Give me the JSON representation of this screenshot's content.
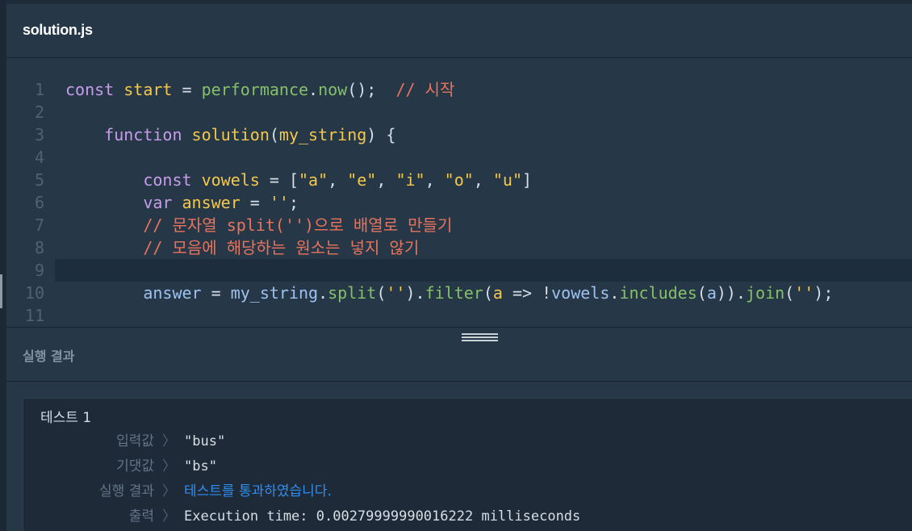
{
  "file_tab": {
    "title": "solution.js"
  },
  "editor": {
    "lines": [
      {
        "no": "1",
        "tokens": [
          [
            "k",
            "const "
          ],
          [
            "d",
            "start"
          ],
          [
            "p",
            " = "
          ],
          [
            "f",
            "performance"
          ],
          [
            "p",
            "."
          ],
          [
            "f",
            "now"
          ],
          [
            "p",
            "();  "
          ],
          [
            "c",
            "// 시작"
          ]
        ]
      },
      {
        "no": "2",
        "tokens": []
      },
      {
        "no": "3",
        "tokens": [
          [
            "p",
            "    "
          ],
          [
            "k",
            "function "
          ],
          [
            "d",
            "solution"
          ],
          [
            "p",
            "("
          ],
          [
            "d",
            "my_string"
          ],
          [
            "p",
            ") {"
          ]
        ]
      },
      {
        "no": "4",
        "tokens": []
      },
      {
        "no": "5",
        "tokens": [
          [
            "p",
            "        "
          ],
          [
            "k",
            "const "
          ],
          [
            "d",
            "vowels"
          ],
          [
            "p",
            " = ["
          ],
          [
            "s",
            "\"a\""
          ],
          [
            "p",
            ", "
          ],
          [
            "s",
            "\"e\""
          ],
          [
            "p",
            ", "
          ],
          [
            "s",
            "\"i\""
          ],
          [
            "p",
            ", "
          ],
          [
            "s",
            "\"o\""
          ],
          [
            "p",
            ", "
          ],
          [
            "s",
            "\"u\""
          ],
          [
            "p",
            "]"
          ]
        ]
      },
      {
        "no": "6",
        "tokens": [
          [
            "p",
            "        "
          ],
          [
            "k",
            "var "
          ],
          [
            "d",
            "answer"
          ],
          [
            "p",
            " = "
          ],
          [
            "s",
            "''"
          ],
          [
            "p",
            ";"
          ]
        ]
      },
      {
        "no": "7",
        "tokens": [
          [
            "p",
            "        "
          ],
          [
            "c",
            "// 문자열 split('')으로 배열로 만들기"
          ]
        ]
      },
      {
        "no": "8",
        "tokens": [
          [
            "p",
            "        "
          ],
          [
            "c",
            "// 모음에 해당하는 원소는 넣지 않기"
          ]
        ]
      },
      {
        "no": "9",
        "tokens": [],
        "active": true
      },
      {
        "no": "10",
        "tokens": [
          [
            "p",
            "        "
          ],
          [
            "v",
            "answer"
          ],
          [
            "p",
            " = "
          ],
          [
            "v",
            "my_string"
          ],
          [
            "p",
            "."
          ],
          [
            "f",
            "split"
          ],
          [
            "p",
            "("
          ],
          [
            "s",
            "''"
          ],
          [
            "p",
            ")."
          ],
          [
            "f",
            "filter"
          ],
          [
            "p",
            "("
          ],
          [
            "d",
            "a"
          ],
          [
            "p",
            " => !"
          ],
          [
            "v",
            "vowels"
          ],
          [
            "p",
            "."
          ],
          [
            "f",
            "includes"
          ],
          [
            "p",
            "("
          ],
          [
            "v",
            "a"
          ],
          [
            "p",
            "))."
          ],
          [
            "f",
            "join"
          ],
          [
            "p",
            "("
          ],
          [
            "s",
            "''"
          ],
          [
            "p",
            ");"
          ]
        ]
      },
      {
        "no": "11",
        "tokens": []
      }
    ]
  },
  "results": {
    "header": "실행 결과",
    "test": {
      "title": "테스트 1",
      "rows": [
        {
          "label": "입력값",
          "value": "\"bus\""
        },
        {
          "label": "기댓값",
          "value": "\"bs\""
        },
        {
          "label": "실행 결과",
          "value": "테스트를 통과하였습니다."
        },
        {
          "label": "출력",
          "value": "Execution time: 0.00279999990016222 milliseconds"
        }
      ]
    }
  },
  "icons": {
    "row_separator": "chevron-right-icon",
    "resize": "drag-handle-icon"
  },
  "colors": {
    "background": "#263747",
    "pass": "#2f8ff0",
    "keyword": "#c79dea",
    "identifier": "#f2c94c",
    "function": "#86c06a",
    "comment": "#e8745d"
  }
}
